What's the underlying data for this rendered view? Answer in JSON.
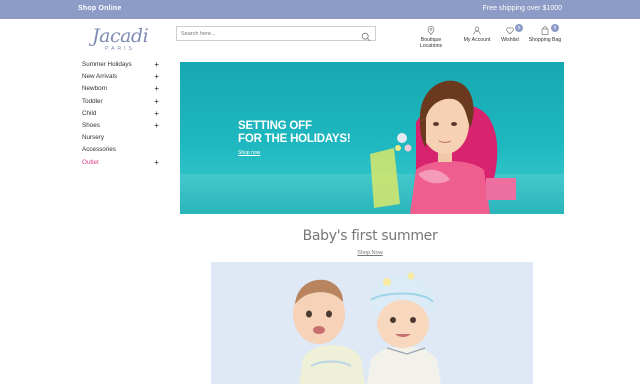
{
  "topbar": {
    "left_text": "Shop Online",
    "right_text": "Free shipping over $1000"
  },
  "logo": {
    "brand": "Jacadi",
    "sub": "PARIS"
  },
  "search": {
    "placeholder": "Search here..."
  },
  "nav_icons": [
    {
      "label": "Boutique Locations",
      "icon": "location-pin-icon"
    },
    {
      "label": "My Account",
      "icon": "user-icon"
    },
    {
      "label": "Wishlist",
      "icon": "heart-icon",
      "badge": "0"
    },
    {
      "label": "Shopping Bag",
      "icon": "bag-icon",
      "badge": "0"
    }
  ],
  "sidebar": {
    "items": [
      {
        "label": "Summer Holidays",
        "expandable": true
      },
      {
        "label": "New Arrivals",
        "expandable": true
      },
      {
        "label": "Newborn",
        "expandable": true
      },
      {
        "label": "Toddler",
        "expandable": true
      },
      {
        "label": "Child",
        "expandable": true
      },
      {
        "label": "Shoes",
        "expandable": true
      },
      {
        "label": "Nursery",
        "expandable": false
      },
      {
        "label": "Accessories",
        "expandable": false
      },
      {
        "label": "Outlet",
        "expandable": true
      }
    ]
  },
  "hero": {
    "line1": "SETTING OFF",
    "line2": "FOR THE HOLIDAYS!",
    "cta": "Shop now"
  },
  "section": {
    "title": "Baby's first summer",
    "cta": "Shop Now"
  },
  "colors": {
    "brand": "#8d9cc6",
    "outlet": "#d9428b",
    "hero_teal": "#1fb8c0"
  }
}
